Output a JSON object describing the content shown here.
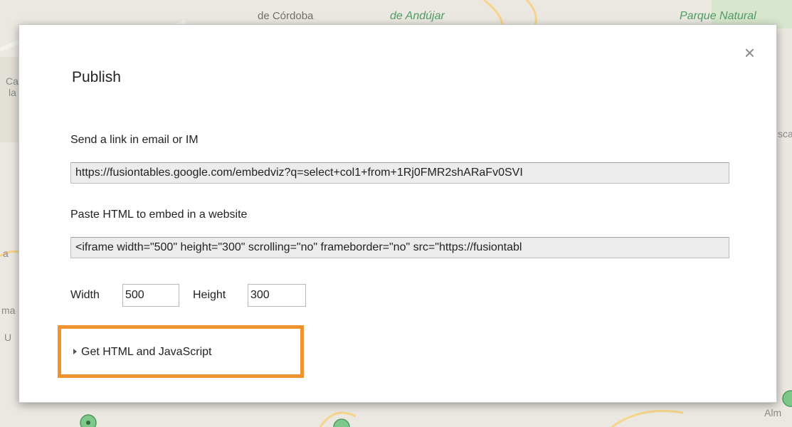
{
  "map": {
    "labels": [
      "de Córdoba",
      "de Andújar",
      "Parque Natural",
      "Ca",
      "la",
      "sca",
      "a",
      "ma",
      "U",
      "Alm"
    ]
  },
  "dialog": {
    "title": "Publish",
    "close_symbol": "×",
    "link_section": {
      "label": "Send a link in email or IM",
      "value": "https://fusiontables.google.com/embedviz?q=select+col1+from+1Rj0FMR2shARaFv0SVI"
    },
    "embed_section": {
      "label": "Paste HTML to embed in a website",
      "value": "<iframe width=\"500\" height=\"300\" scrolling=\"no\" frameborder=\"no\" src=\"https://fusiontabl"
    },
    "size": {
      "width_label": "Width",
      "width_value": "500",
      "height_label": "Height",
      "height_value": "300"
    },
    "get_html_link": "Get HTML and JavaScript"
  },
  "colors": {
    "highlight": "#f0922e",
    "map_green_label": "#4c9c63",
    "map_marker": "#7dc88a"
  }
}
